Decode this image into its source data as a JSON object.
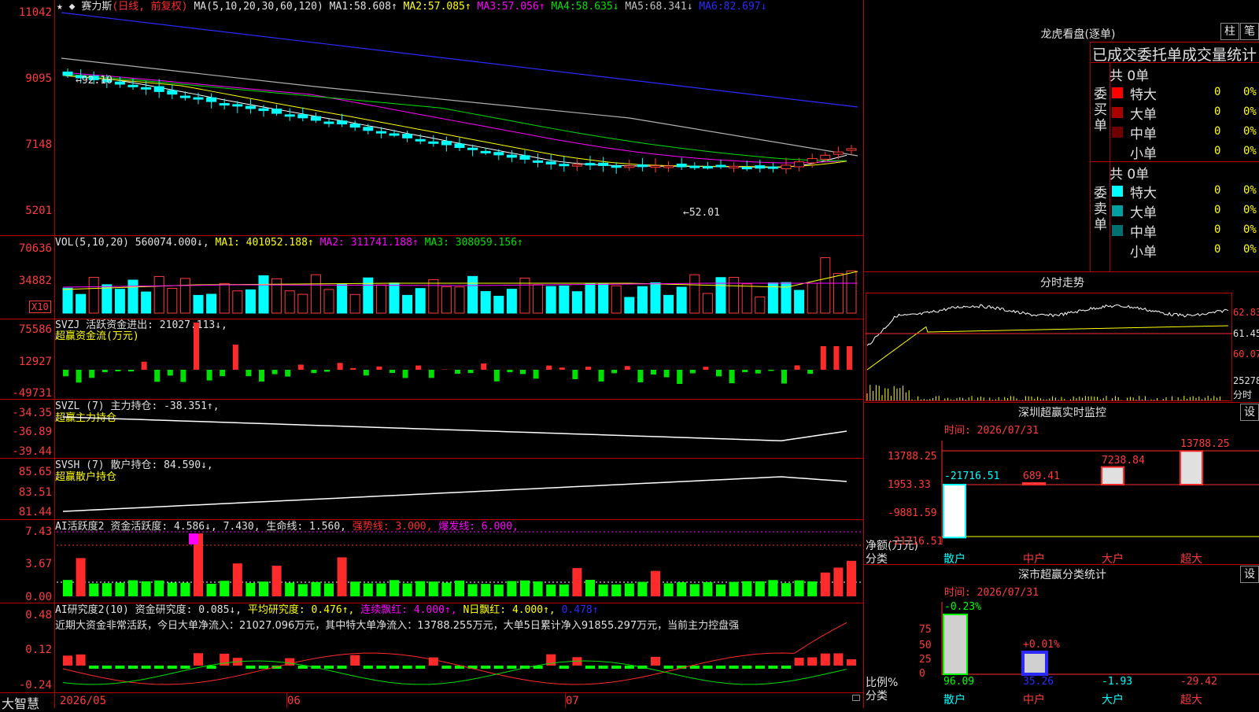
{
  "main": {
    "stock_name": "赛力斯",
    "period": "(日线, 前复权)",
    "ma_label": "MA(5,10,20,30,60,120)",
    "ma": [
      {
        "label": "MA1:",
        "value": "58.608↑",
        "color": "#ffffff"
      },
      {
        "label": "MA2:",
        "value": "57.085↑",
        "color": "#ffff00"
      },
      {
        "label": "MA3:",
        "value": "57.056↑",
        "color": "#ff00ff"
      },
      {
        "label": "MA4:",
        "value": "58.635↓",
        "color": "#00e000"
      },
      {
        "label": "MA5:",
        "value": "68.341↓",
        "color": "#c0c0c0"
      },
      {
        "label": "MA6:",
        "value": "82.697↓",
        "color": "#2b2bff"
      }
    ],
    "y_ticks": [
      "11042",
      "9095",
      "7148",
      "5201"
    ],
    "high_mark": "92.10",
    "low_mark": "52.01",
    "ma_colors": {
      "ma1": "#ffffff",
      "ma2": "#ffff00",
      "ma3": "#ff00ff",
      "ma4": "#00e000",
      "ma5": "#c0c0c0",
      "ma6": "#2b2bff"
    }
  },
  "vol": {
    "label": "VOL(5,10,20)",
    "value": "560074.000↓,",
    "ma1": "MA1: 401052.188↑",
    "ma2": "MA2: 311741.188↑",
    "ma3": "MA3: 308059.156↑",
    "y_ticks": [
      "70636",
      "34882"
    ],
    "unit": "X10"
  },
  "svzj": {
    "name": "SVZJ",
    "field": "活跃资金进出: 21027.113↓,",
    "subtitle": "超赢资金流(万元)",
    "y_ticks": [
      "75586",
      "12927",
      "-49731"
    ]
  },
  "svzl": {
    "name": "SVZL (7)",
    "field": "主力持仓: -38.351↑,",
    "subtitle": "超赢主力持仓",
    "y_ticks": [
      "-34.35",
      "-36.89",
      "-39.44"
    ]
  },
  "svsh": {
    "name": "SVSH (7)",
    "field": "散户持仓: 84.590↓,",
    "subtitle": "超赢散户持仓",
    "y_ticks": [
      "85.65",
      "83.51",
      "81.44"
    ]
  },
  "ai1": {
    "name": "AI活跃度2",
    "f1": "资金活跃度: 4.586↓, 7.430,",
    "f2": "生命线: 1.560,",
    "f3": "强势线: 3.000,",
    "f4": "爆发线: 6.000,",
    "y_ticks": [
      "7.43",
      "3.67",
      "0.00"
    ]
  },
  "ai2": {
    "name": "AI研究度2(10)",
    "f1": "资金研究度: 0.085↓,",
    "f2": "平均研究度: 0.476↑,",
    "f3": "连续飘红: 4.000↑,",
    "f4": "N日飘红: 4.000↑,",
    "f5": "0.478↑",
    "note": "近期大资金非常活跃，今日大单净流入：21027.096万元，其中特大单净流入：13788.255万元，大单5日累计净入91855.297万元，当前主力控盘强",
    "y_ticks": [
      "0.48",
      "0.12",
      "-0.24"
    ]
  },
  "footer": {
    "brand": "大智慧",
    "dates": [
      "2026/05",
      "06",
      "07"
    ]
  },
  "lhkp": {
    "title": "龙虎看盘(逐单)",
    "btn1": "柱",
    "btn2": "笔",
    "header": "已成交委托单成交量统计",
    "buy_label": "委买单",
    "sell_label": "委卖单",
    "buy_total": "共 0单",
    "sell_total": "共 0单",
    "buy_rows": [
      {
        "label": "特大",
        "count": "0",
        "pct": "0%",
        "color": "#ff0000"
      },
      {
        "label": "大单",
        "count": "0",
        "pct": "0%",
        "color": "#aa0000"
      },
      {
        "label": "中单",
        "count": "0",
        "pct": "0%",
        "color": "#700000"
      },
      {
        "label": "小单",
        "count": "0",
        "pct": "0%",
        "color": ""
      }
    ],
    "sell_rows": [
      {
        "label": "特大",
        "count": "0",
        "pct": "0%",
        "color": "#00ffff"
      },
      {
        "label": "大单",
        "count": "0",
        "pct": "0%",
        "color": "#00a0a0"
      },
      {
        "label": "中单",
        "count": "0",
        "pct": "0%",
        "color": "#007070"
      },
      {
        "label": "小单",
        "count": "0",
        "pct": "0%",
        "color": ""
      }
    ]
  },
  "intraday": {
    "title": "分时走势",
    "prices": [
      "62.83",
      "61.45",
      "60.07"
    ],
    "vol": "25278",
    "vol_label": "分时"
  },
  "realtime": {
    "title": "深圳超赢实时监控",
    "set_btn": "设",
    "time": "时间: 2026/07/31",
    "y_ticks": [
      "13788.25",
      "1953.33",
      "-9881.59",
      "-21716.51"
    ],
    "y_caption": "净额(万元)",
    "x_caption": "分类",
    "categories": [
      "散户",
      "中户",
      "大户",
      "超大"
    ],
    "values": [
      "-21716.51",
      "689.41",
      "7238.84",
      "13788.25"
    ]
  },
  "classify": {
    "title": "深市超赢分类统计",
    "set_btn": "设",
    "time": "时间: 2026/07/31",
    "y_ticks": [
      "75",
      "50",
      "25",
      "0"
    ],
    "y_caption": "比例%",
    "x_caption": "分类",
    "categories": [
      "散户",
      "中户",
      "大户",
      "超大"
    ],
    "top_labels": [
      "-0.23%",
      "+0.01%"
    ],
    "values": [
      "96.09",
      "35.26",
      "-1.93",
      "-29.42"
    ]
  }
}
